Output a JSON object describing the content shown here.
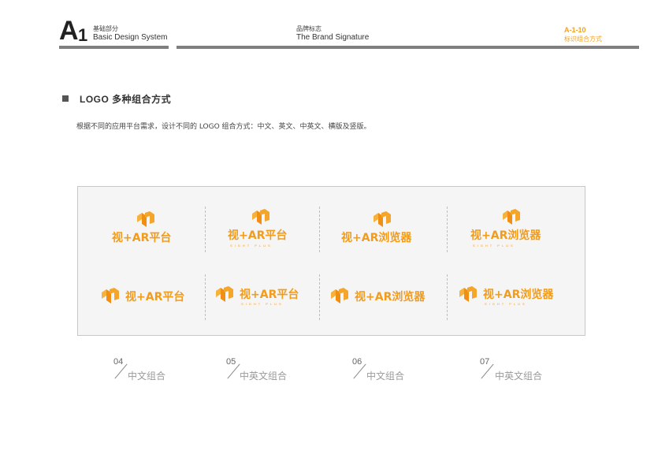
{
  "header": {
    "section_letter": "A",
    "section_number": "1",
    "section_cn": "基础部分",
    "section_en": "Basic Design System",
    "chapter_cn": "品牌标志",
    "chapter_en": "The Brand Signature",
    "page_code": "A-1-10",
    "page_code_sub": "标识组合方式"
  },
  "section": {
    "title": "LOGO 多种组合方式",
    "description": "根据不同的应用平台需求，设计不同的 LOGO 组合方式：中文、英文、中英文、横版及竖版。"
  },
  "logos": {
    "row1": [
      {
        "text": "视+AR平台",
        "sub": ""
      },
      {
        "text": "视+AR平台",
        "sub": "SIGHT PLUS"
      },
      {
        "text": "视+AR浏览器",
        "sub": ""
      },
      {
        "text": "视+AR浏览器",
        "sub": "SIGHT PLUS"
      }
    ],
    "row2": [
      {
        "text": "视+AR平台",
        "sub": ""
      },
      {
        "text": "视+AR平台",
        "sub": "SIGHT PLUS"
      },
      {
        "text": "视+AR浏览器",
        "sub": ""
      },
      {
        "text": "视+AR浏览器",
        "sub": "SIGHT PLUS"
      }
    ]
  },
  "captions": [
    {
      "num": "04",
      "label": "中文组合"
    },
    {
      "num": "05",
      "label": "中英文组合"
    },
    {
      "num": "06",
      "label": "中文组合"
    },
    {
      "num": "07",
      "label": "中英文组合"
    }
  ],
  "colors": {
    "brand_orange": "#f19c1d",
    "accent_code": "#f0a226",
    "rule_gray": "#7f7f7f"
  }
}
